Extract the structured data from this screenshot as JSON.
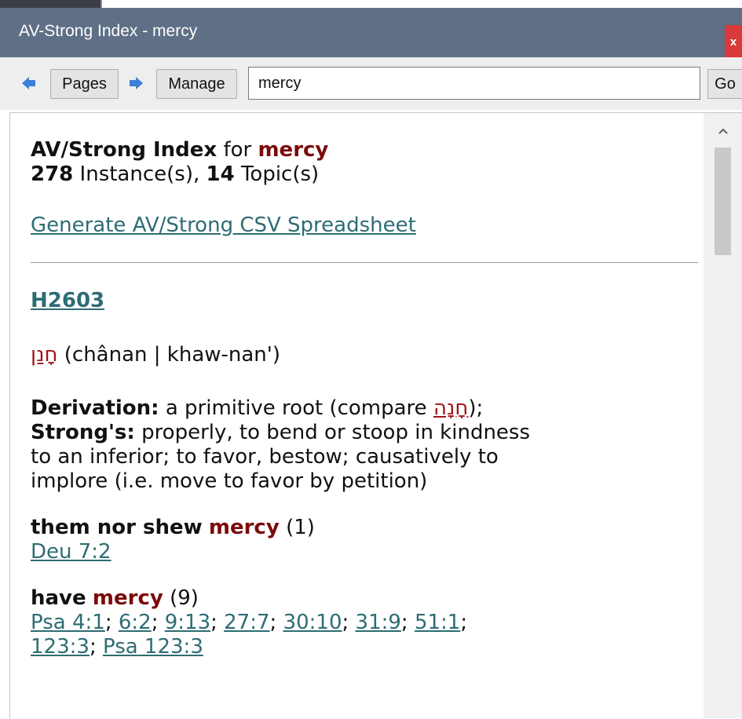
{
  "window": {
    "title": "AV-Strong Index - mercy",
    "close_glyph": "x"
  },
  "toolbar": {
    "back_icon": "left-arrow-icon",
    "pages_label": "Pages",
    "forward_icon": "right-arrow-icon",
    "manage_label": "Manage",
    "search_value": "mercy",
    "go_label": "Go"
  },
  "colors": {
    "titlebar": "#5f6f86",
    "accent_red": "#7a0a0a",
    "link": "#2e6c74",
    "arrow_blue": "#3d7fd9"
  },
  "header": {
    "index_title": "AV/Strong Index",
    "for_word": "for",
    "query": "mercy",
    "instance_count": "278",
    "instance_label": "Instance(s),",
    "topic_count": "14",
    "topic_label": "Topic(s)",
    "csv_link": "Generate AV/Strong CSV Spreadsheet"
  },
  "entry": {
    "strongs_id": "H2603",
    "hebrew": "חָנַן",
    "translit": "(chânan | khaw-nan')",
    "derivation_label": "Derivation:",
    "derivation_text": "a primitive root (compare",
    "derivation_ref": "חָנָה",
    "derivation_end": ");",
    "strongs_label": "Strong's:",
    "strongs_line1": "properly, to bend or stoop in kindness",
    "strongs_line2": "to an inferior; to favor, bestow; causatively to",
    "strongs_line3": "implore (i.e. move to favor by petition)"
  },
  "usages": [
    {
      "prefix": "them nor shew",
      "keyword": "mercy",
      "count": "(1)",
      "refs": [
        "Deu 7:2"
      ]
    },
    {
      "prefix": "have",
      "keyword": "mercy",
      "count": "(9)",
      "refs": [
        "Psa 4:1",
        "6:2",
        "9:13",
        "27:7",
        "30:10",
        "31:9",
        "51:1"
      ],
      "refs_line2": [
        "123:3",
        "Psa 123:3"
      ]
    }
  ],
  "scrollbar": {
    "up_icon": "chevron-up-icon"
  }
}
